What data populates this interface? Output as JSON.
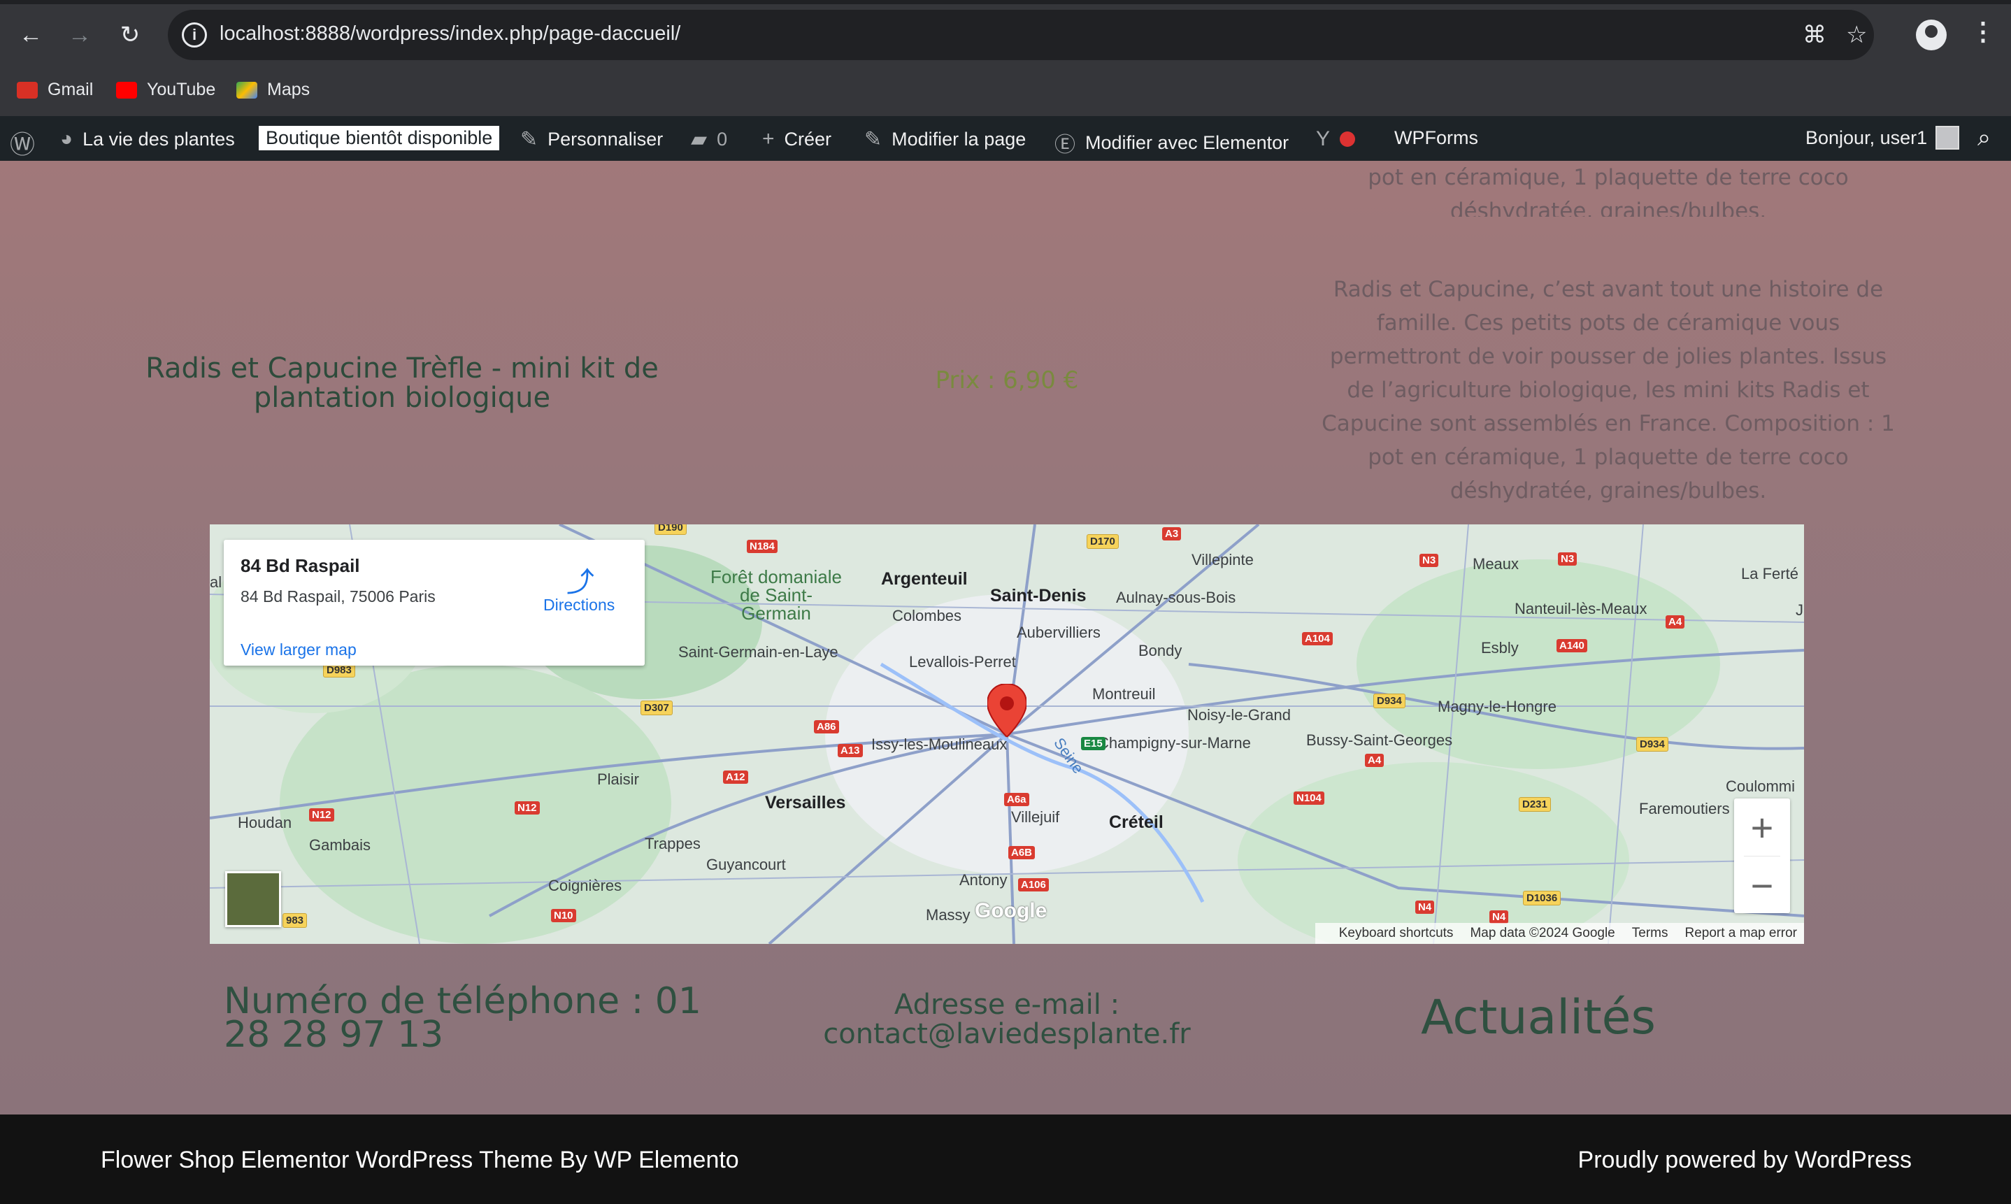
{
  "browser": {
    "url": "localhost:8888/wordpress/index.php/page-daccueil/",
    "bookmarks": [
      {
        "label": "Gmail",
        "icon": "gmail-icon",
        "color": "#d93025"
      },
      {
        "label": "YouTube",
        "icon": "youtube-icon",
        "color": "#ff0000"
      },
      {
        "label": "Maps",
        "icon": "maps-icon",
        "color": "#34a853"
      }
    ]
  },
  "adminbar": {
    "site": "La vie des plantes",
    "boutique": "Boutique bientôt disponible",
    "customize": "Personnaliser",
    "comments": "0",
    "new": "Créer",
    "edit": "Modifier la page",
    "elementor": "Modifier avec Elementor",
    "wpforms": "WPForms",
    "greeting": "Bonjour, user1"
  },
  "product": {
    "desc_top": "pot en céramique, 1 plaquette de terre coco déshydratée, graines/bulbes.",
    "title": "Radis et Capucine Trèfle - mini kit de plantation biologique",
    "price": "Prix : 6,90 €",
    "description": "Radis et Capucine, c’est avant tout une histoire de famille. Ces petits pots de céramique vous permettront de voir pousser de jolies plantes. Issus de l’agriculture biologique, les mini kits Radis et Capucine sont assemblés en France. Composition : 1 pot en céramique, 1 plaquette de terre coco déshydratée, graines/bulbes."
  },
  "map": {
    "card_title": "84 Bd Raspail",
    "card_address": "84 Bd Raspail, 75006 Paris",
    "directions": "Directions",
    "larger": "View larger map",
    "zoom_in": "+",
    "zoom_out": "−",
    "logo": "Google",
    "attribution": [
      "Keyboard shortcuts",
      "Map data ©2024 Google",
      "Terms",
      "Report a map error"
    ],
    "places": {
      "argenteuil": "Argenteuil",
      "saint_denis": "Saint-Denis",
      "colombes": "Colombes",
      "aubervilliers": "Aubervilliers",
      "villepinte": "Villepinte",
      "aulnay": "Aulnay-sous-Bois",
      "bondy": "Bondy",
      "levallois": "Levallois-Perret",
      "sgel": "Saint-Germain-en-Laye",
      "foret": "Forêt domaniale de Saint-Germain",
      "montreuil": "Montreuil",
      "noisy": "Noisy-le-Grand",
      "champigny": "Champigny-sur-Marne",
      "issy": "Issy-les-Moulineaux",
      "versailles": "Versailles",
      "plaisir": "Plaisir",
      "villejuif": "Villejuif",
      "creteil": "Créteil",
      "trappes": "Trappes",
      "guyancourt": "Guyancourt",
      "coignieres": "Coignières",
      "antony": "Antony",
      "massy": "Massy",
      "houdan": "Houdan",
      "gambais": "Gambais",
      "meaux": "Meaux",
      "la_ferte": "La Ferté",
      "nanteuil": "Nanteuil-lès-Meaux",
      "esbly": "Esbly",
      "magny": "Magny-le-Hongre",
      "bussy": "Bussy-Saint-Georges",
      "faremoutiers": "Faremoutiers",
      "coulommiers": "Coulommi",
      "seine": "Seine",
      "al": "al",
      "j": "J"
    },
    "roads": {
      "n184": "N184",
      "d170": "D170",
      "a3": "A3",
      "n3a": "N3",
      "n3b": "N3",
      "a104": "A104",
      "a140": "A140",
      "a4a": "A4",
      "d983a": "D983",
      "d307": "D307",
      "a86": "A86",
      "a13": "A13",
      "e15": "E15",
      "d934a": "D934",
      "a4b": "A4",
      "d934b": "D934",
      "a12": "A12",
      "n12a": "N12",
      "n12b": "N12",
      "a6a": "A6a",
      "n104": "N104",
      "d231": "D231",
      "a6b": "A6B",
      "a106": "A106",
      "n10": "N10",
      "d983b": "983",
      "n4a": "N4",
      "n4b": "N4",
      "d1036": "D1036",
      "d190": "D190"
    }
  },
  "contact": {
    "phone": "Numéro de téléphone : 01 28 28 97 13",
    "email": "Adresse e-mail : contact@laviedesplante.fr",
    "news": "Actualités"
  },
  "footer": {
    "left": "Flower Shop Elementor WordPress Theme By WP Elemento",
    "right": "Proudly powered by WordPress"
  }
}
